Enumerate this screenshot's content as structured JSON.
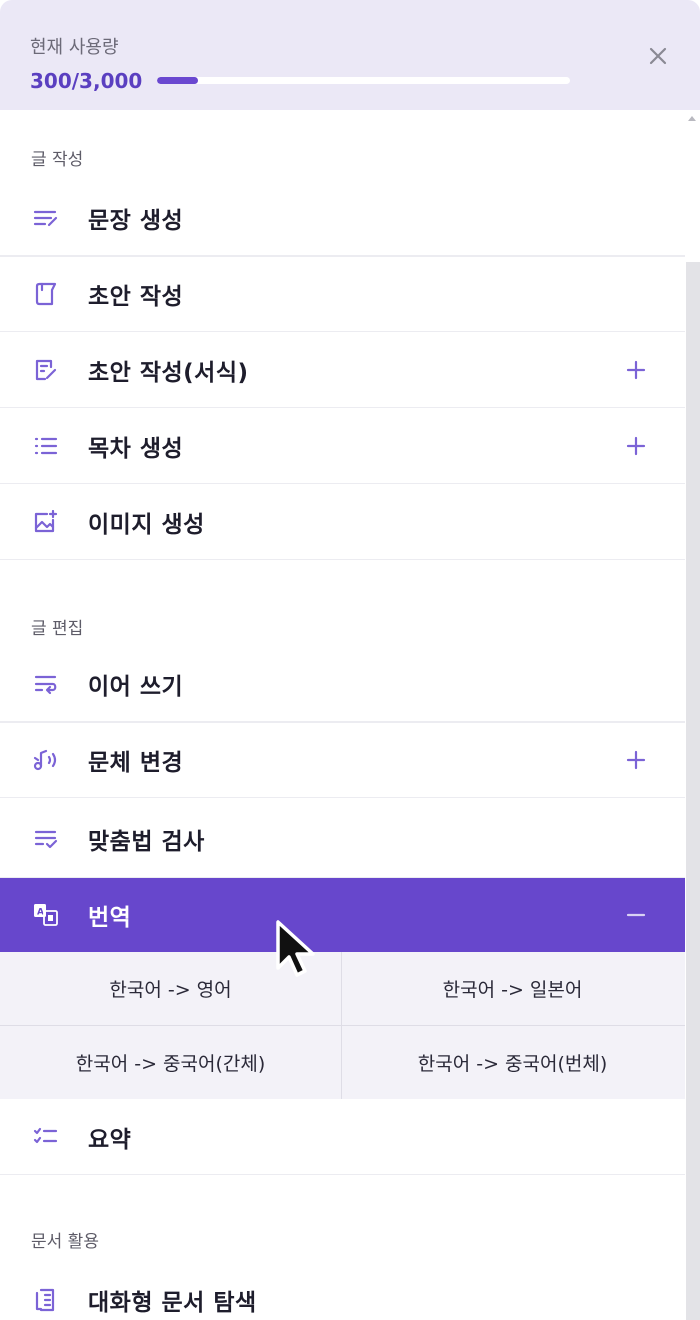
{
  "header": {
    "usage_label": "현재 사용량",
    "usage_count": "300/3,000",
    "usage_progress": 0.1,
    "close_icon": "close-icon"
  },
  "sections": {
    "writing": {
      "title": "글 작성",
      "items": [
        {
          "label": "문장 생성",
          "icon": "sentence-lines-icon"
        },
        {
          "label": "초안 작성",
          "icon": "draft-book-icon"
        },
        {
          "label": "초안 작성(서식)",
          "icon": "document-edit-icon",
          "expandable": true
        },
        {
          "label": "목차 생성",
          "icon": "list-icon",
          "expandable": true
        },
        {
          "label": "이미지 생성",
          "icon": "image-add-icon"
        }
      ]
    },
    "editing": {
      "title": "글 편집",
      "items": [
        {
          "label": "이어 쓰기",
          "icon": "wrap-text-icon"
        },
        {
          "label": "문체 변경",
          "icon": "music-voice-icon",
          "expandable": true
        },
        {
          "label": "맞춤법 검사",
          "icon": "spellcheck-icon"
        },
        {
          "label": "번역",
          "icon": "translate-icon",
          "expanded": true
        },
        {
          "label": "요약",
          "icon": "checklist-icon"
        }
      ]
    },
    "documents": {
      "title": "문서 활용",
      "items": [
        {
          "label": "대화형 문서 탐색",
          "icon": "document-search-icon"
        }
      ]
    }
  },
  "translation_options": [
    "한국어 -> 영어",
    "한국어 -> 일본어",
    "한국어 -> 중국어(간체)",
    "한국어 -> 중국어(번체)"
  ],
  "colors": {
    "accent": "#6747cc",
    "header_bg": "#ebe8f6",
    "icon": "#7b63d6",
    "submenu_bg": "#f3f2f8"
  }
}
